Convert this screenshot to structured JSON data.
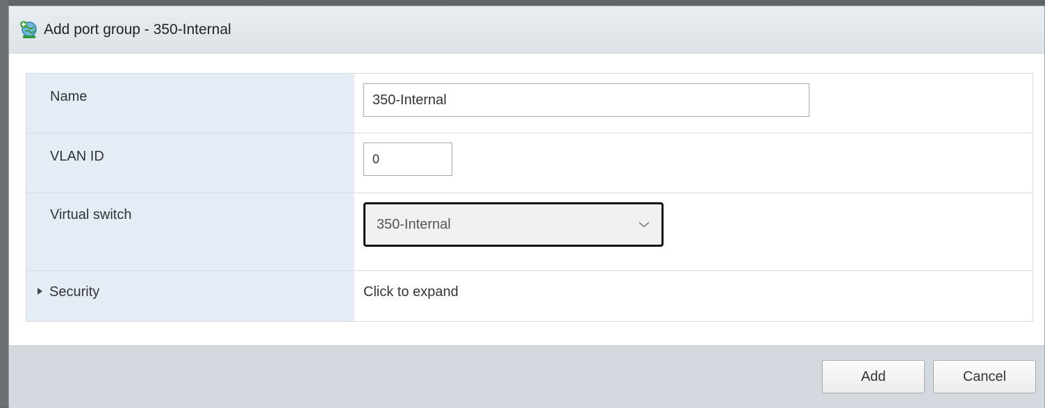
{
  "dialog": {
    "title": "Add port group - 350-Internal",
    "title_icon": "add-port-group-icon"
  },
  "form": {
    "name": {
      "label": "Name",
      "value": "350-Internal"
    },
    "vlan": {
      "label": "VLAN ID",
      "value": "0"
    },
    "vswitch": {
      "label": "Virtual switch",
      "selected": "350-Internal"
    },
    "security": {
      "label": "Security",
      "value": "Click to expand"
    }
  },
  "footer": {
    "add_label": "Add",
    "cancel_label": "Cancel"
  }
}
